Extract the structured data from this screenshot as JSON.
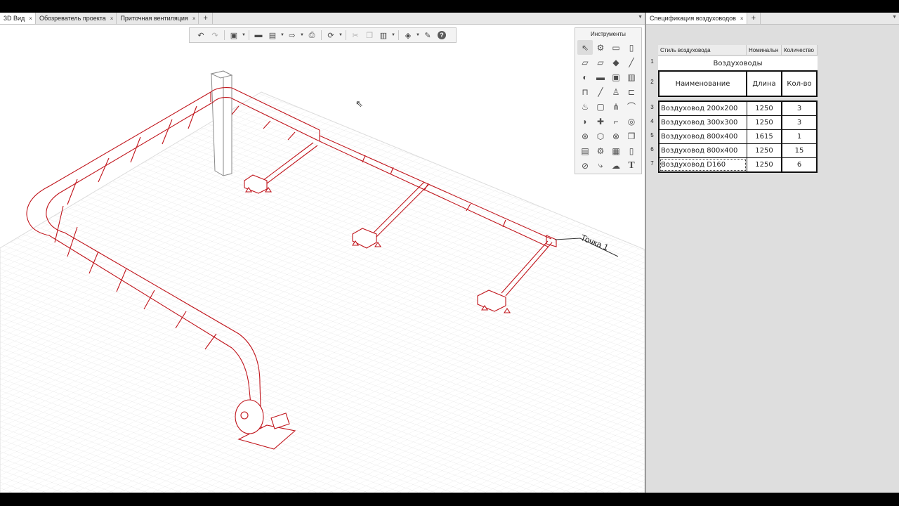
{
  "left_tabs": [
    {
      "label": "3D Вид",
      "active": true
    },
    {
      "label": "Обозреватель проекта",
      "active": false
    },
    {
      "label": "Приточная вентиляция",
      "active": false
    }
  ],
  "right_tabs": [
    {
      "label": "Спецификация воздуховодов",
      "active": true
    }
  ],
  "tab_close_glyph": "×",
  "tab_add_glyph": "+",
  "colors": {
    "duct_line": "#c0141b",
    "grid_line": "#e6e6e6",
    "pane_bg": "#dedede"
  },
  "toolbar_icons": [
    "undo-icon",
    "redo-icon",
    "cube-view-icon",
    "open-folder-icon",
    "save-icon",
    "export-icon",
    "print-icon",
    "orbit-icon",
    "cut-icon",
    "copy-icon",
    "paste-icon",
    "layers-icon",
    "wrench-icon",
    "help-icon"
  ],
  "tools_panel": {
    "title": "Инструменты",
    "icons": [
      "select-arrow-icon",
      "fitting-icon",
      "rect-duct-icon",
      "round-duct-icon",
      "flat-duct-icon",
      "flat-duct-2-icon",
      "eraser-icon",
      "ruler-icon",
      "bend-icon",
      "pipe-icon",
      "device-icon",
      "cabinet-icon",
      "grille-icon",
      "line-icon",
      "valve-icon",
      "reducer-icon",
      "fan-icon",
      "box-icon",
      "tee-icon",
      "flex-icon",
      "damper-icon",
      "cross-icon",
      "elbow-icon",
      "spiral-icon",
      "group-icon",
      "shield-icon",
      "multi-icon",
      "copy-obj-icon",
      "stack-icon",
      "gear-icon",
      "camera-icon",
      "door-icon",
      "axis-icon",
      "branch-icon",
      "cloud-icon",
      "text-icon"
    ]
  },
  "scene": {
    "label": "Точка 1"
  },
  "spec": {
    "col_headers": [
      "Стиль воздуховода",
      "Номинальн",
      "Количество"
    ],
    "row_numbers": [
      "1",
      "2",
      "3",
      "4",
      "5",
      "6",
      "7"
    ],
    "group_title": "Воздуховоды",
    "table_headers": [
      "Наименование",
      "Длина",
      "Кол-во"
    ],
    "rows": [
      {
        "name": "Воздуховод 200x200",
        "length": "1250",
        "qty": "3"
      },
      {
        "name": "Воздуховод 300x300",
        "length": "1250",
        "qty": "3"
      },
      {
        "name": "Воздуховод 800x400",
        "length": "1615",
        "qty": "1"
      },
      {
        "name": "Воздуховод 800x400",
        "length": "1250",
        "qty": "15"
      },
      {
        "name": "Воздуховод D160",
        "length": "1250",
        "qty": "6"
      }
    ]
  }
}
